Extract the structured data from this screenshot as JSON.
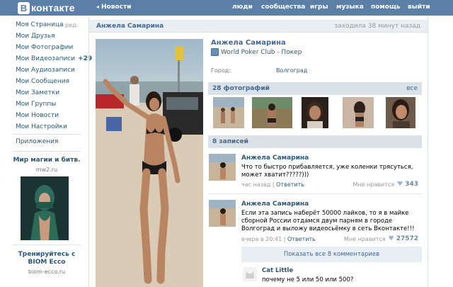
{
  "header": {
    "logo_letter": "В",
    "logo_text": "контакте",
    "news_link": "Новости",
    "nav": [
      "люди",
      "сообщества",
      "игры",
      "музыка",
      "помощь",
      "выйти"
    ]
  },
  "sidebar": {
    "items": [
      {
        "label": "Моя Страница",
        "extra": "ред."
      },
      {
        "label": "Мои Друзья"
      },
      {
        "label": "Мои Фотографии"
      },
      {
        "label": "Мои Видеозаписи",
        "count": "+29"
      },
      {
        "label": "Мои Аудиозаписи"
      },
      {
        "label": "Мои Сообщения"
      },
      {
        "label": "Мои Заметки"
      },
      {
        "label": "Мои Группы"
      },
      {
        "label": "Мои Новости"
      },
      {
        "label": "Мои Настройки"
      }
    ],
    "apps": "Приложения",
    "ads": [
      {
        "title": "Мир магии и битв.",
        "domain": "mw2.ru"
      },
      {
        "title": "Тренируйтесь с BIOM Ecco",
        "domain": "biom-ecco.ru"
      }
    ]
  },
  "profile": {
    "name": "Анжела Самарина",
    "last_seen": "заходила 38 минут назад",
    "status": "World Poker Club - Покер",
    "city_label": "Город:",
    "city": "Волгоград"
  },
  "photos": {
    "title": "28 фотографий",
    "all_link": "все",
    "thumbs": [
      {
        "bg": "#b7a68c"
      },
      {
        "bg": "#8b7a55"
      },
      {
        "bg": "#3f2e24"
      },
      {
        "bg": "#c9b6a4"
      },
      {
        "bg": "#8a6f5c"
      }
    ]
  },
  "wall": {
    "title": "8 записей",
    "like_label": "Мне нравится",
    "reply_label": "Ответить",
    "posts": [
      {
        "author": "Анжела Самарина",
        "text": "Что то быстро прибавляется, уже коленки трясуться, может хватит?????)))",
        "time": "час назад",
        "likes": "343"
      },
      {
        "author": "Анжела Самарина",
        "text": "Если эта запись наберёт 50000 лайков, то я в майке сборной России отдамся двум парням в городе Волгоград и выложу видеосьёмку в сеть Вконтакте!!!",
        "time": "вчера в 20:41",
        "likes": "27572"
      }
    ],
    "show_comments": "Показать все 8 комментариев",
    "comment": {
      "author": "Cat Little",
      "text": "почему не 5 или 50 или 500?"
    }
  },
  "colors": {
    "header_bg": "#5b7fa6",
    "link": "#2b587a",
    "section_bg": "#dae2e8"
  }
}
